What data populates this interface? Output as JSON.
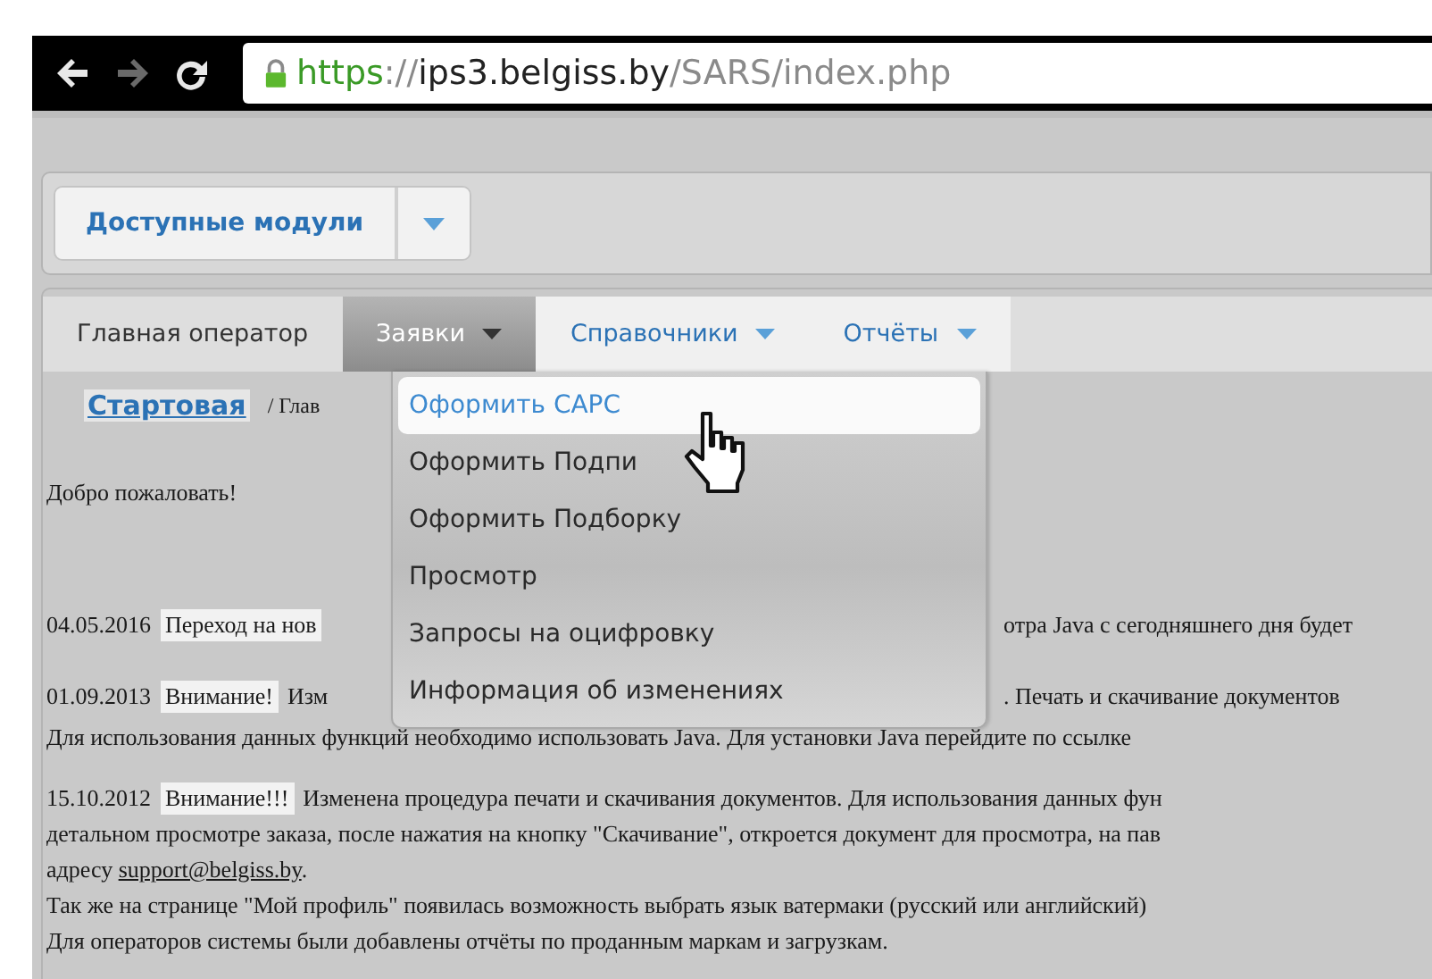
{
  "browser": {
    "url": {
      "scheme": "https",
      "separator": "://",
      "host": "ips3.belgiss.by",
      "path": "/SARS/index.php"
    }
  },
  "modules_button": {
    "label": "Доступные модули"
  },
  "tabs": [
    {
      "label": "Главная оператор",
      "selected": false,
      "has_menu": false
    },
    {
      "label": "Заявки",
      "selected": true,
      "has_menu": true
    },
    {
      "label": "Справочники",
      "selected": false,
      "has_menu": true
    },
    {
      "label": "Отчёты",
      "selected": false,
      "has_menu": true
    }
  ],
  "breadcrumb": {
    "link": "Стартовая",
    "current": "/ Глав"
  },
  "welcome": "Добро пожаловать!",
  "dropdown": [
    {
      "label": "Оформить САРС",
      "highlighted": true
    },
    {
      "label": "Оформить Подпи",
      "highlighted": false
    },
    {
      "label": "Оформить Подборку",
      "highlighted": false
    },
    {
      "label": "Просмотр",
      "highlighted": false
    },
    {
      "label": "Запросы на оцифровку",
      "highlighted": false
    },
    {
      "label": "Информация об изменениях",
      "highlighted": false
    }
  ],
  "news": [
    {
      "date": "04.05.2016",
      "tag": "Переход на нов",
      "text_right": "отра Java с сегодняшнего дня будет"
    },
    {
      "date": "01.09.2013",
      "tag": "Внимание!",
      "text_left": "Изм",
      "text_right": ". Печать и скачивание документов",
      "lines": [
        {
          "before": "Для использования данных функций необходимо использовать Java. Для установки Java перейдите по ссылке"
        }
      ]
    },
    {
      "date": "15.10.2012",
      "tag": "Внимание!!!",
      "text_left": "Изменена процедура печати и скачивания документов. Для использования данных фун",
      "lines": [
        {
          "before": "детальном просмотре заказа, после нажатия на кнопку \"Скачивание\", откроется документ для просмотра, на пав"
        },
        {
          "before": "адресу ",
          "link": "support@belgiss.by",
          "after": "."
        },
        {
          "before": "Так же на странице \"Мой профиль\" появилась возможность выбрать язык ватермаки (русский или английский)"
        },
        {
          "before": "Для операторов системы были добавлены отчёты по проданным маркам и загрузкам."
        }
      ]
    }
  ]
}
